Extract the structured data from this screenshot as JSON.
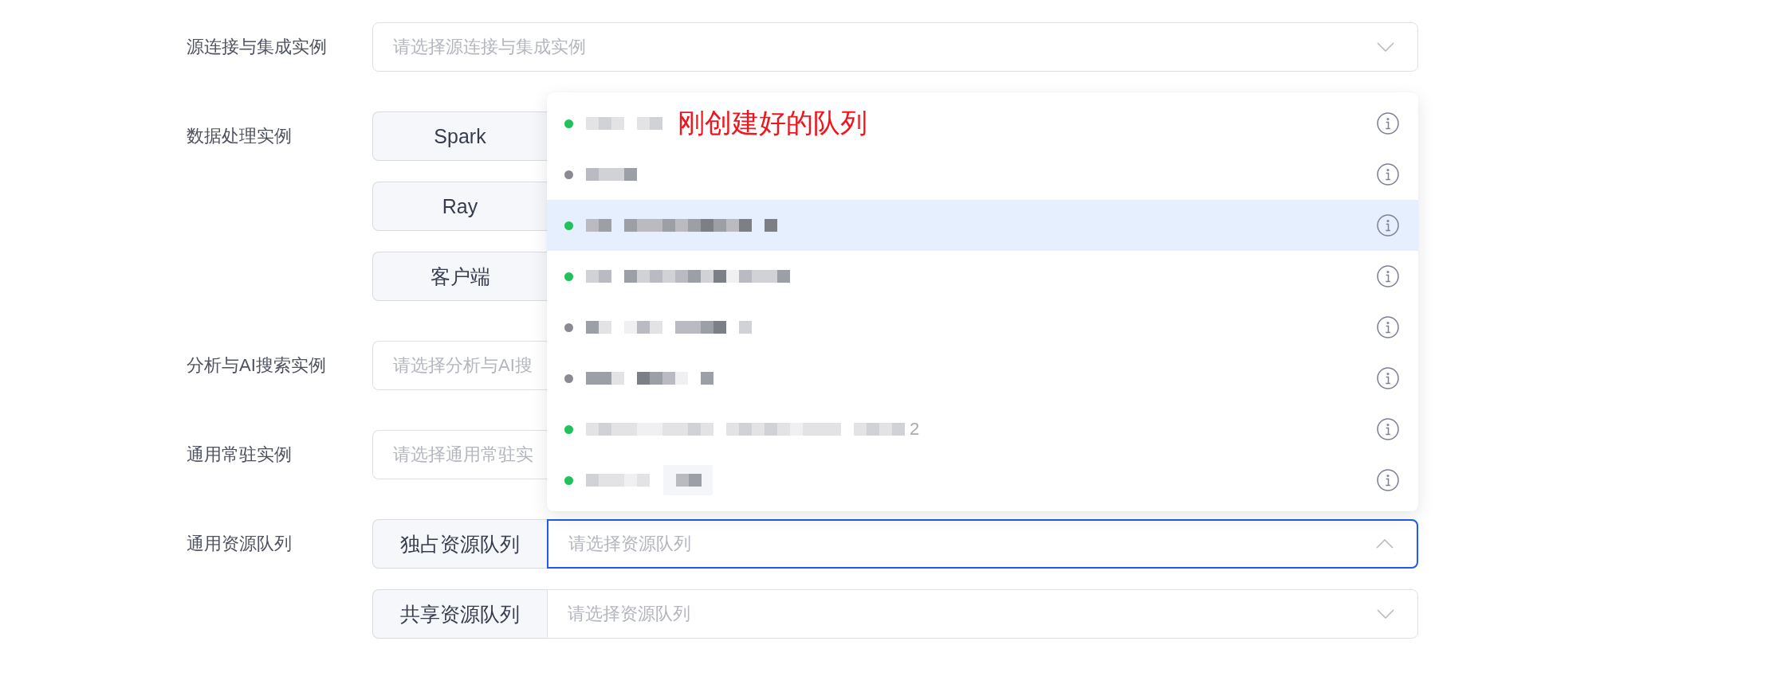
{
  "form": {
    "rows": [
      {
        "label": "源连接与集成实例",
        "fields": [
          {
            "placeholder": "请选择源连接与集成实例",
            "open": false
          }
        ]
      },
      {
        "label": "数据处理实例",
        "fields": [
          {
            "addon": "Spark"
          },
          {
            "addon": "Ray"
          },
          {
            "addon": "客户端"
          }
        ]
      },
      {
        "label": "分析与AI搜索实例",
        "fields": [
          {
            "placeholder": "请选择分析与AI搜",
            "open": false
          }
        ]
      },
      {
        "label": "通用常驻实例",
        "fields": [
          {
            "placeholder": "请选择通用常驻实",
            "open": false
          }
        ]
      },
      {
        "label": "通用资源队列",
        "fields": [
          {
            "addon": "独占资源队列",
            "placeholder": "请选择资源队列",
            "open": true,
            "options": [
              {
                "color": "#1ec45a",
                "name_pixelated": true,
                "tag_pixelated": false,
                "selected": false,
                "annotation": "刚创建好的队列"
              },
              {
                "color": "#8a8a94",
                "name_pixelated": true,
                "tag_pixelated": false,
                "selected": false
              },
              {
                "color": "#1ec45a",
                "name_pixelated": true,
                "tag_pixelated": false,
                "selected": true
              },
              {
                "color": "#1ec45a",
                "name_pixelated": true,
                "tag_pixelated": false,
                "selected": false
              },
              {
                "color": "#8a8a94",
                "name_pixelated": true,
                "tag_pixelated": false,
                "selected": false
              },
              {
                "color": "#8a8a94",
                "name_pixelated": true,
                "tag_pixelated": false,
                "selected": false
              },
              {
                "color": "#1ec45a",
                "name_pixelated": true,
                "tag_pixelated": false,
                "selected": false,
                "name_tail": "2"
              },
              {
                "color": "#1ec45a",
                "name_pixelated": true,
                "tag_pixelated": true,
                "selected": false
              }
            ]
          },
          {
            "addon": "共享资源队列",
            "placeholder": "请选择资源队列",
            "open": false
          }
        ]
      }
    ]
  }
}
